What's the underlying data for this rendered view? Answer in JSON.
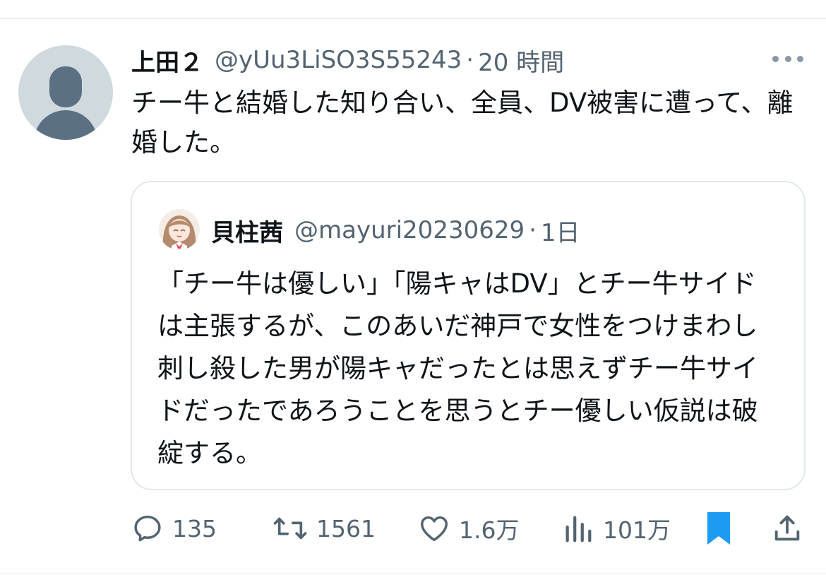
{
  "tweet": {
    "display_name": "上田２",
    "handle": "@yUu3LiSO3S55243",
    "separator": "·",
    "time": "20 時間",
    "text": "チー牛と結婚した知り合い、全員、DV被害に遭って、離婚した。"
  },
  "quote": {
    "display_name": "貝柱茜",
    "handle": "@mayuri20230629",
    "separator": "·",
    "time": "1日",
    "text": "「チー牛は優しい」「陽キャはDV」とチー牛サイドは主張するが、このあいだ神戸で女性をつけまわし刺し殺した男が陽キャだったとは思えずチー牛サイドだったであろうことを思うとチー優しい仮説は破綻する。"
  },
  "actions": {
    "replies": "135",
    "retweets": "1561",
    "likes": "1.6万",
    "views": "101万"
  },
  "icons": {
    "reply": "reply-icon",
    "retweet": "retweet-icon",
    "like": "heart-icon",
    "views": "views-icon",
    "bookmark": "bookmark-icon",
    "share": "share-icon",
    "more": "more-icon"
  },
  "colors": {
    "text_primary": "#0f1419",
    "text_secondary": "#536471",
    "accent": "#1d9bf0",
    "divider": "#e6e9ec"
  }
}
